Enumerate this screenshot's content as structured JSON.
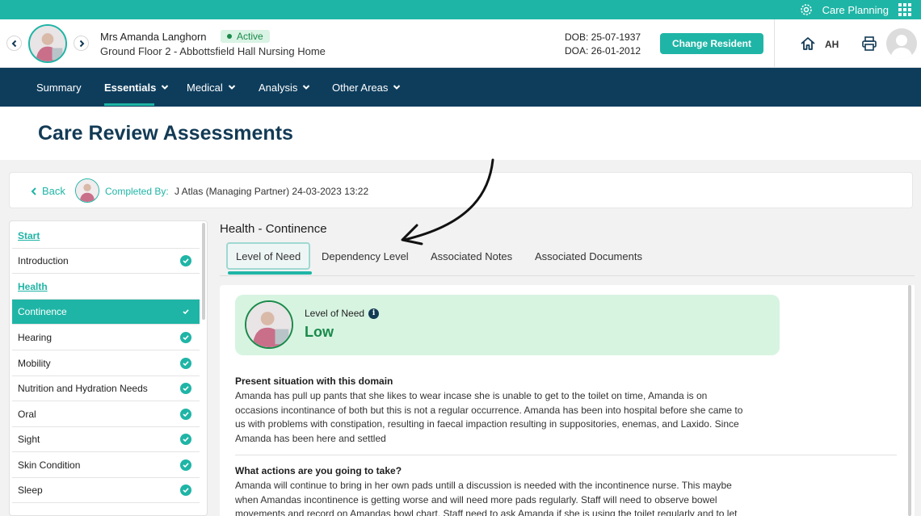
{
  "topbar": {
    "app_name": "Care Planning",
    "icons": [
      "gear-icon",
      "apps-grid-icon"
    ]
  },
  "resident": {
    "name": "Mrs Amanda Langhorn",
    "status": "Active",
    "location": "Ground Floor 2 - Abbottsfield Hall Nursing Home",
    "dob": "DOB: 25-07-1937",
    "doa": "DOA: 26-01-2012",
    "change_button": "Change Resident",
    "user_initials": "AH"
  },
  "nav": {
    "items": [
      {
        "label": "Summary",
        "dropdown": false
      },
      {
        "label": "Essentials",
        "dropdown": true,
        "active": true
      },
      {
        "label": "Medical",
        "dropdown": true
      },
      {
        "label": "Analysis",
        "dropdown": true
      },
      {
        "label": "Other Areas",
        "dropdown": true
      }
    ]
  },
  "page": {
    "title": "Care Review Assessments"
  },
  "completed": {
    "back_label": "Back",
    "label": "Completed By:",
    "value": "J Atlas (Managing Partner) 24-03-2023 13:22"
  },
  "sidebar": {
    "items": [
      {
        "label": "Start",
        "type": "section"
      },
      {
        "label": "Introduction",
        "checked": true
      },
      {
        "label": "Health",
        "type": "section"
      },
      {
        "label": "Continence",
        "checked": true,
        "active": true
      },
      {
        "label": "Hearing",
        "checked": true
      },
      {
        "label": "Mobility",
        "checked": true
      },
      {
        "label": "Nutrition and Hydration Needs",
        "checked": true
      },
      {
        "label": "Oral",
        "checked": true
      },
      {
        "label": "Sight",
        "checked": true
      },
      {
        "label": "Skin Condition",
        "checked": true
      },
      {
        "label": "Sleep",
        "checked": true
      }
    ]
  },
  "section": {
    "title": "Health - Continence",
    "tabs": [
      {
        "label": "Level of Need",
        "active": true
      },
      {
        "label": "Dependency Level"
      },
      {
        "label": "Associated Notes"
      },
      {
        "label": "Associated Documents"
      }
    ]
  },
  "need": {
    "label": "Level of Need",
    "value": "Low"
  },
  "questions": [
    {
      "title": "Present situation with this domain",
      "lines": [
        "Amanda has pull up pants that she likes to wear incase she is unable to get to the toilet on time, Amanda is on",
        "occasions incontinance of both but this is not a regular occurrence. Amanda has been into hospital before she came to",
        "us with problems with constipation, resulting in faecal impaction resulting in suppositories, enemas, and Laxido. Since",
        "Amanda has been here and settled"
      ]
    },
    {
      "title": "What actions are you going to take?",
      "lines": [
        "Amanda will continue to bring in her own pads untill a discussion is needed with the incontinence nurse. This maybe",
        "when Amandas incontinence is getting worse and will need more pads regularly. Staff will need to observe bowel",
        "movements and record on Amandas bowl chart. Staff need to ask Amanda if she is using the toilet regularly and to let"
      ]
    }
  ],
  "colors": {
    "accent": "#1fb5a6",
    "navy": "#0e3d5c",
    "success": "#1a8a4a",
    "need_bg": "#d7f4e1"
  }
}
